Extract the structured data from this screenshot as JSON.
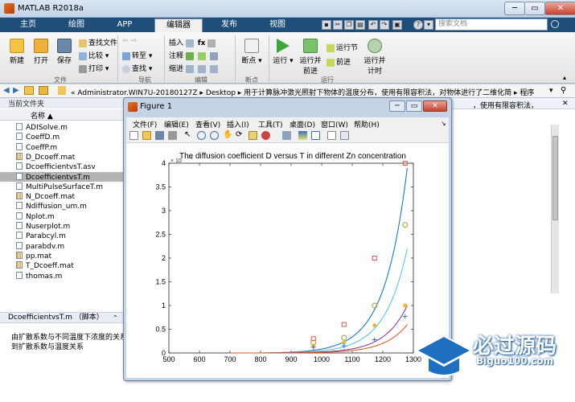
{
  "window": {
    "title": "MATLAB R2018a",
    "min": "─",
    "max": "▭",
    "close": "✕"
  },
  "tabs": [
    {
      "label": "主页"
    },
    {
      "label": "绘图"
    },
    {
      "label": "APP"
    },
    {
      "label": "编辑器"
    },
    {
      "label": "发布"
    },
    {
      "label": "视图"
    }
  ],
  "search": {
    "placeholder": "搜索文档"
  },
  "ribbon": {
    "file": {
      "new": "新建",
      "open": "打开",
      "save": "保存",
      "find_files": "查找文件",
      "compare": "比较",
      "print": "打印",
      "group": "文件"
    },
    "nav": {
      "goto": "转至",
      "find": "查找",
      "group": "导航"
    },
    "edit": {
      "insert": "插入",
      "comment": "注释",
      "indent": "缩进",
      "group": "编辑"
    },
    "breakpoints": {
      "label": "断点",
      "group": "断点"
    },
    "run": {
      "run": "运行",
      "run_advance_1": "运行并",
      "run_advance_2": "前进",
      "run_section": "运行节",
      "advance": "前进",
      "run_time_1": "运行并",
      "run_time_2": "计时",
      "group": "运行"
    }
  },
  "address": {
    "path": "« Administrator.WIN7U-20180127Z ▸ Desktop ▸ 用于计算脉冲激光照射下物体的温度分布，使用有限容积法，对物体进行了二维化简 ▸ 程序"
  },
  "left_panel": {
    "title": "当前文件夹",
    "column": "名称 ▲",
    "files": [
      {
        "name": "ADISolve.m",
        "type": "m"
      },
      {
        "name": "CoeffD.m",
        "type": "m"
      },
      {
        "name": "CoeffP.m",
        "type": "m"
      },
      {
        "name": "D_Dcoeff.mat",
        "type": "mat"
      },
      {
        "name": "DcoefficientvsT.asv",
        "type": "m"
      },
      {
        "name": "DcoefficientvsT.m",
        "type": "m",
        "selected": true
      },
      {
        "name": "MultiPulseSurfaceT.m",
        "type": "m"
      },
      {
        "name": "N_Dcoeff.mat",
        "type": "mat"
      },
      {
        "name": "Ndiffusion_um.m",
        "type": "m"
      },
      {
        "name": "Nplot.m",
        "type": "m"
      },
      {
        "name": "Nuserplot.m",
        "type": "m"
      },
      {
        "name": "Parabcyl.m",
        "type": "m"
      },
      {
        "name": "parabdv.m",
        "type": "m"
      },
      {
        "name": "pp.mat",
        "type": "mat"
      },
      {
        "name": "T_Dcoeff.mat",
        "type": "mat"
      },
      {
        "name": "thomas.m",
        "type": "m"
      }
    ],
    "detail_title": "DcoefficientvsT.m （脚本）",
    "detail_lines": [
      "由扩散系数与不同温度下浓度的关系画",
      "到扩散系数与温度关系"
    ]
  },
  "editor_snippet": "，使用有限容积法，",
  "figure": {
    "title": "Figure 1",
    "menu": [
      "文件(F)",
      "编辑(E)",
      "查看(V)",
      "插入(I)",
      "工具(T)",
      "桌面(D)",
      "窗口(W)",
      "帮助(H)"
    ],
    "exponent": "× 10",
    "exponent_power": "-4"
  },
  "chart_data": {
    "type": "line",
    "title": "The diffusion coefficient D versus T in different Zn concentration",
    "xlabel": "",
    "ylabel": "",
    "xlim": [
      500,
      1300
    ],
    "ylim": [
      0,
      4
    ],
    "x_ticks": [
      500,
      600,
      700,
      800,
      900,
      1000,
      1100,
      1200,
      1300
    ],
    "y_ticks": [
      0,
      0.5,
      1,
      1.5,
      2,
      2.5,
      3,
      3.5,
      4
    ],
    "series": [
      {
        "color": "#0072bd",
        "marker": "square",
        "marker_color": "#d9534f",
        "points": [
          [
            973,
            0.3
          ],
          [
            1073,
            0.6
          ],
          [
            1173,
            2.0
          ],
          [
            1273,
            4.0
          ]
        ],
        "curve_end": 3.9
      },
      {
        "color": "#4dbeee",
        "marker": "circle",
        "marker_color": "#a2a233",
        "points": [
          [
            973,
            0.22
          ],
          [
            1073,
            0.32
          ],
          [
            1173,
            1.0
          ],
          [
            1273,
            2.7
          ]
        ],
        "curve_end": 2.2
      },
      {
        "color": "#7e2f8e",
        "marker": "star",
        "marker_color": "#edb120",
        "points": [
          [
            973,
            0.15
          ],
          [
            1073,
            0.22
          ],
          [
            1173,
            0.58
          ],
          [
            1273,
            1.0
          ]
        ],
        "curve_end": 1.0
      },
      {
        "color": "#d95319",
        "marker": "plus",
        "marker_color": "#3a78c2",
        "points": [
          [
            973,
            0.12
          ],
          [
            1073,
            0.15
          ],
          [
            1173,
            0.28
          ],
          [
            1273,
            0.77
          ]
        ],
        "curve_end": 0.6
      }
    ]
  },
  "watermark": {
    "cn": "必过源码",
    "en": "Biguo100.com"
  },
  "colors": {
    "tab_bg": "#1f4e78",
    "ribbon_bg": "#efefef",
    "selection": "#b4b4b4"
  }
}
